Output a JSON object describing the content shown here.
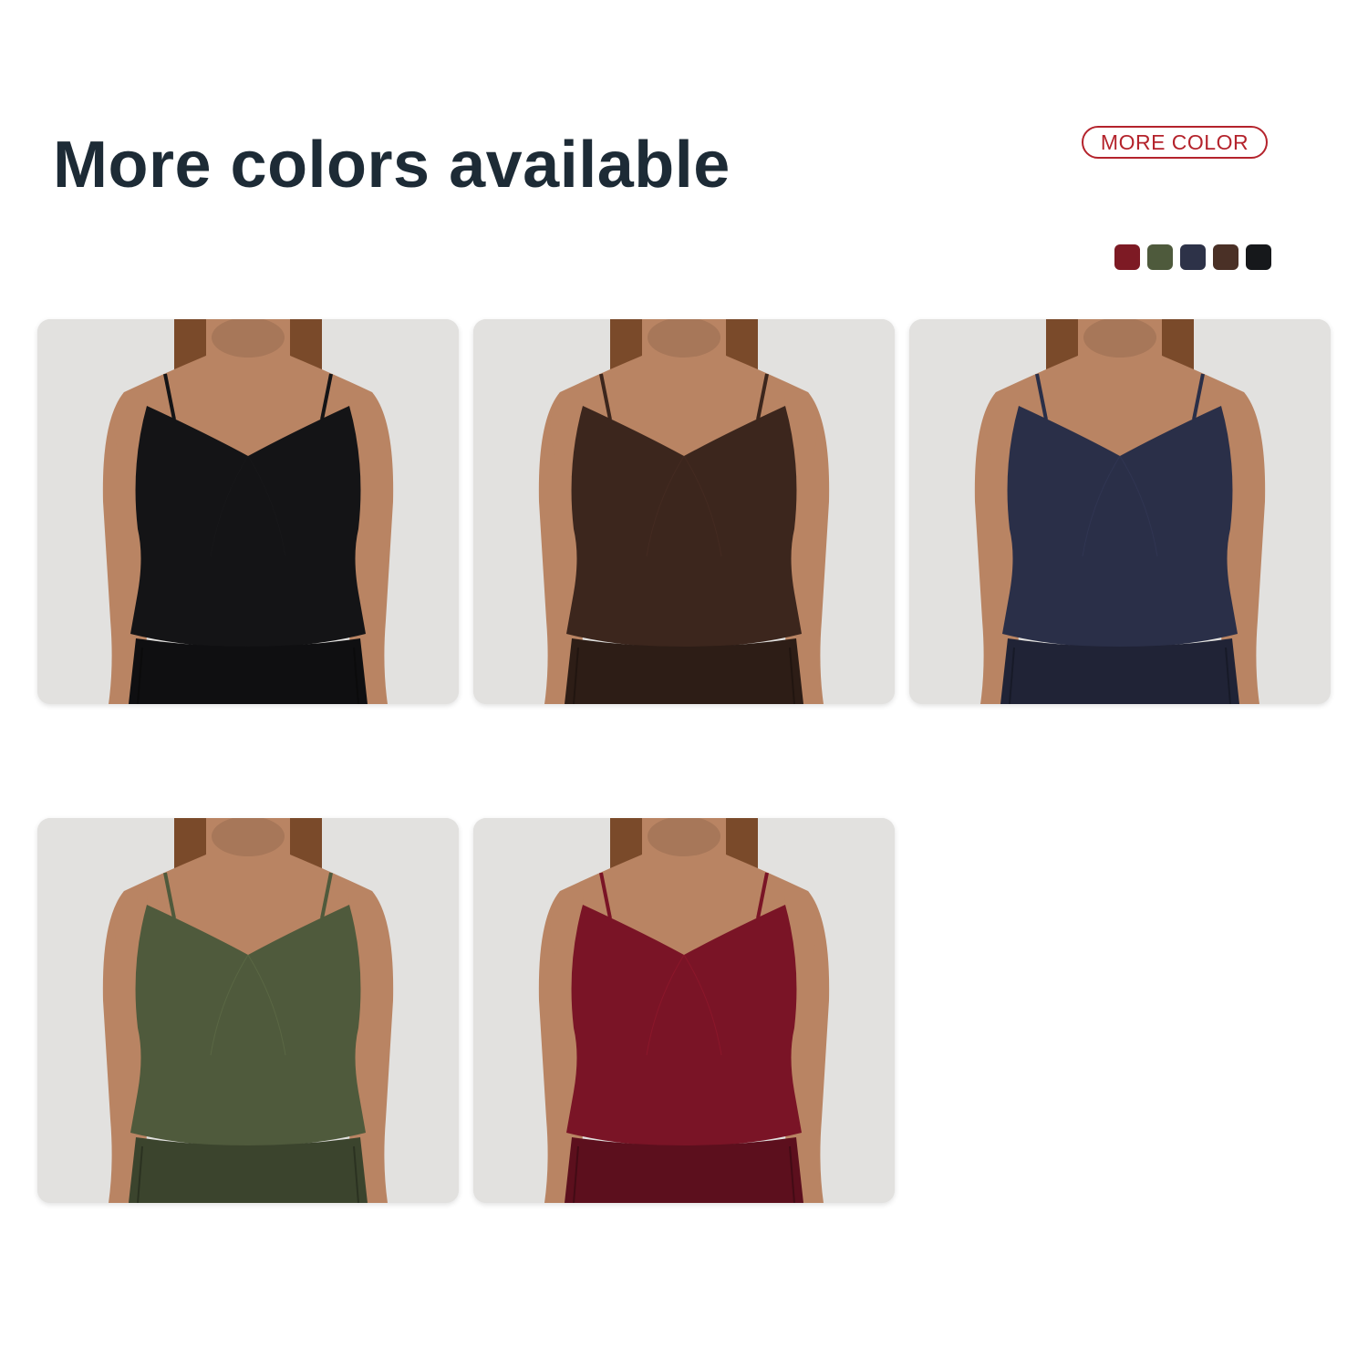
{
  "header": {
    "title": "More colors available",
    "more_color_label": "MORE COLOR"
  },
  "swatches": [
    {
      "name": "wine-red-swatch",
      "color": "#7d1a24"
    },
    {
      "name": "olive-green-swatch",
      "color": "#4e5a3c"
    },
    {
      "name": "navy-swatch",
      "color": "#2d3248"
    },
    {
      "name": "brown-swatch",
      "color": "#4a3026"
    },
    {
      "name": "black-swatch",
      "color": "#16181b"
    }
  ],
  "products": [
    {
      "name": "black-tank",
      "color": "#141416"
    },
    {
      "name": "brown-tank",
      "color": "#3c261d"
    },
    {
      "name": "navy-tank",
      "color": "#2a2f48"
    },
    {
      "name": "olive-tank",
      "color": "#4f5a3c"
    },
    {
      "name": "wine-red-tank",
      "color": "#7a1426"
    }
  ],
  "palette": {
    "title_color": "#1d2b36",
    "accent": "#b4232c",
    "skin": "#b98463",
    "hair": "#7a4a2a",
    "card_bg": "#e2e1df"
  }
}
